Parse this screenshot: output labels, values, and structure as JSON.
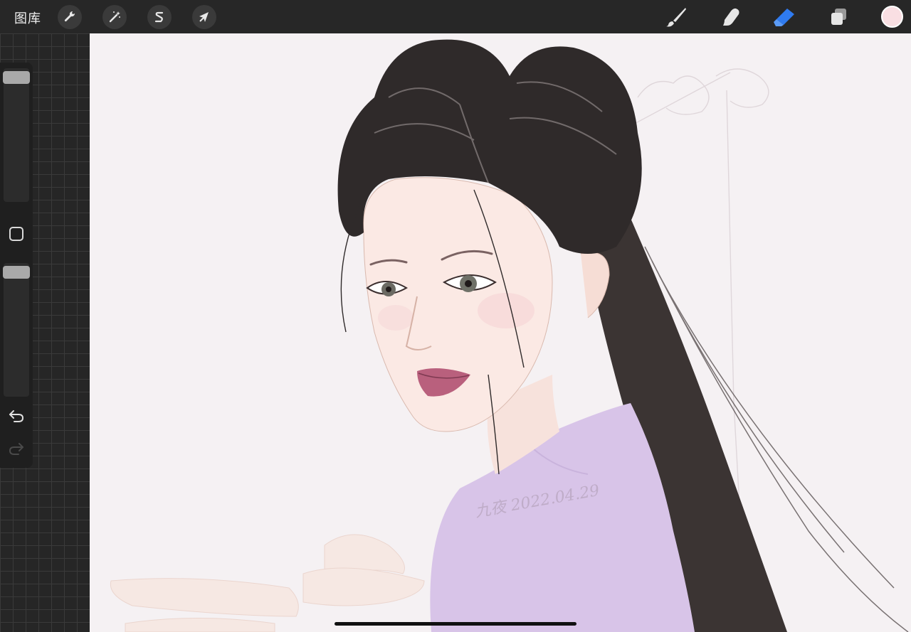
{
  "toolbar": {
    "gallery_label": "图库",
    "left_tools": [
      {
        "name": "actions",
        "icon": "wrench-icon"
      },
      {
        "name": "adjustments",
        "icon": "magic-wand-icon"
      },
      {
        "name": "selection",
        "icon": "selection-s-icon"
      },
      {
        "name": "transform",
        "icon": "arrow-cursor-icon"
      }
    ],
    "right_tools": [
      {
        "name": "brush",
        "icon": "brush-icon",
        "active": false
      },
      {
        "name": "smudge",
        "icon": "smudge-finger-icon",
        "active": false
      },
      {
        "name": "eraser",
        "icon": "eraser-icon",
        "active": true
      },
      {
        "name": "layers",
        "icon": "layers-icon",
        "active": false
      }
    ],
    "current_color": "#f9dfe3",
    "active_tool_color": "#2f7bf0"
  },
  "sidebar": {
    "brush_size_level": 0.95,
    "opacity_level": 0.95,
    "modifier_icon": "square-icon",
    "undo_icon": "undo-icon",
    "redo_icon": "redo-icon"
  },
  "canvas": {
    "signature_text": "九夜 2022.04.29"
  }
}
